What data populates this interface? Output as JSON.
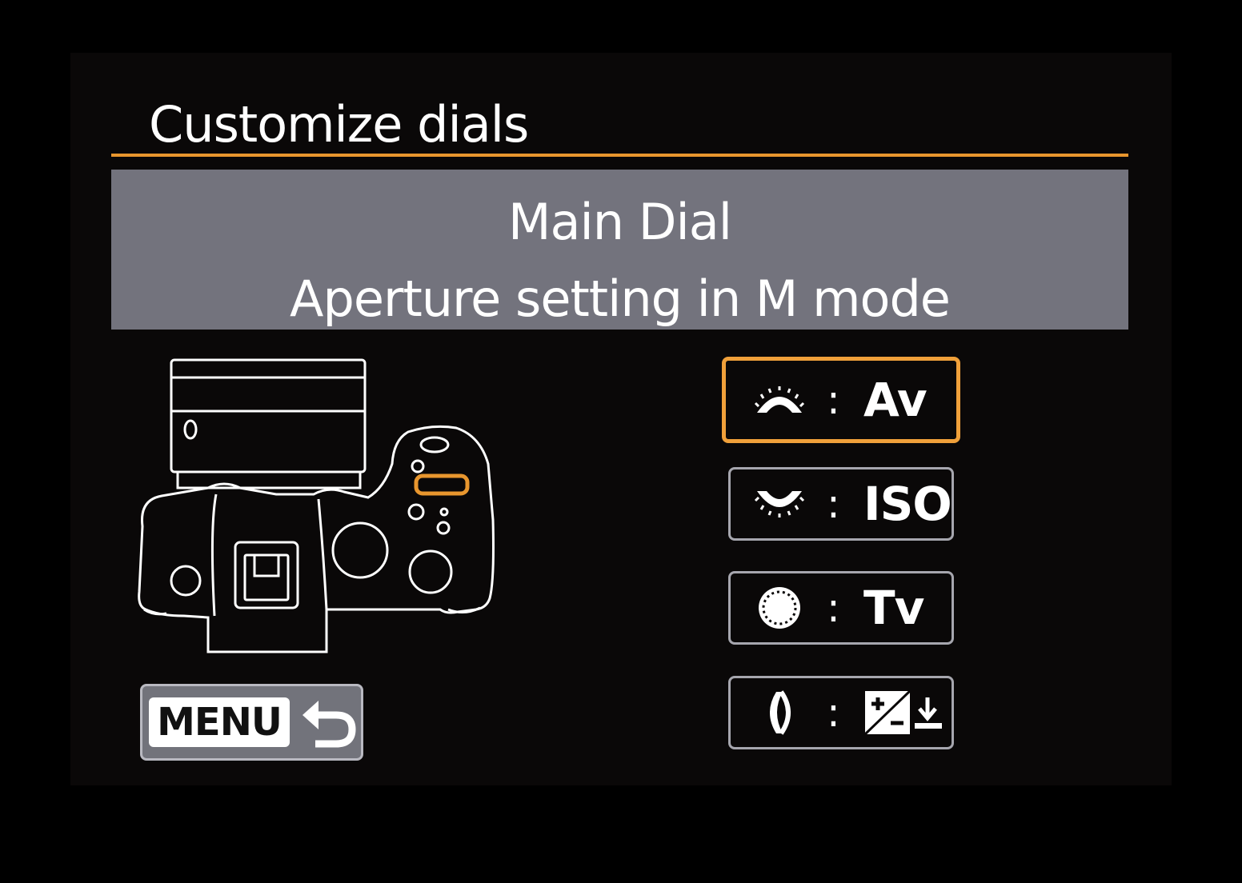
{
  "screen": {
    "title": "Customize dials",
    "accent_color": "#e8962e"
  },
  "description": {
    "line1": "Main Dial",
    "line2": "Aperture setting in M mode"
  },
  "options": [
    {
      "icon": "main-dial-icon",
      "colon": ":",
      "value": "Av",
      "selected": true
    },
    {
      "icon": "quick-control-dial-icon",
      "colon": ":",
      "value": "ISO",
      "selected": false
    },
    {
      "icon": "control-ring-icon",
      "colon": ":",
      "value": "Tv",
      "selected": false
    },
    {
      "icon": "lens-ring-icon",
      "colon": ":",
      "value": "",
      "selected": false
    }
  ],
  "menu_button": {
    "label": "MENU",
    "icon": "return-arrow-icon"
  }
}
